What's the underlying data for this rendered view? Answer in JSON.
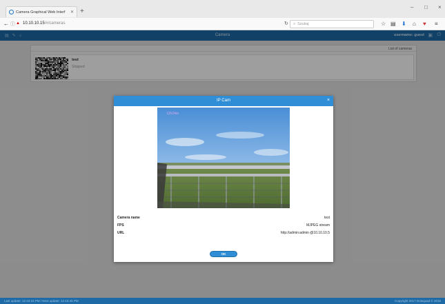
{
  "browser": {
    "tab_title": "Camera Graphical Web Interf",
    "tab_close": "✕",
    "new_tab": "+",
    "url_host": "10.10.10.15",
    "url_path": "/#/cameras",
    "search_placeholder": "Szukaj",
    "icons": [
      "back-arrow-icon",
      "info-icon",
      "lock-icon",
      "reload-icon",
      "search-icon",
      "star-icon",
      "reading-list-icon",
      "download-icon",
      "home-icon",
      "pocket-icon",
      "menu-icon"
    ]
  },
  "header": {
    "title": "Camera",
    "username": "username: guest"
  },
  "list": {
    "title": "List of cameras",
    "cameras": [
      {
        "name": "test",
        "status": "Stopped"
      }
    ]
  },
  "modal": {
    "title": "IP Cam",
    "close": "×",
    "feed_overlay": "12h24m",
    "info": [
      {
        "label": "Camera name",
        "value": "test"
      },
      {
        "label": "FPS",
        "value": "MJPEG stream"
      },
      {
        "label": "URL",
        "value": "http://admin:admin @10.10.10.5"
      }
    ],
    "ok_label": "OK"
  },
  "statusbar": {
    "left": "Last update: 12:16:15 PM / Next update: 12:16:45 PM",
    "right": "Copyright 2017 Dotsquad © 2016"
  },
  "colors": {
    "header": "#1d6aa6",
    "modal_header": "#2f8ed6",
    "button": "#2f8ed6"
  }
}
